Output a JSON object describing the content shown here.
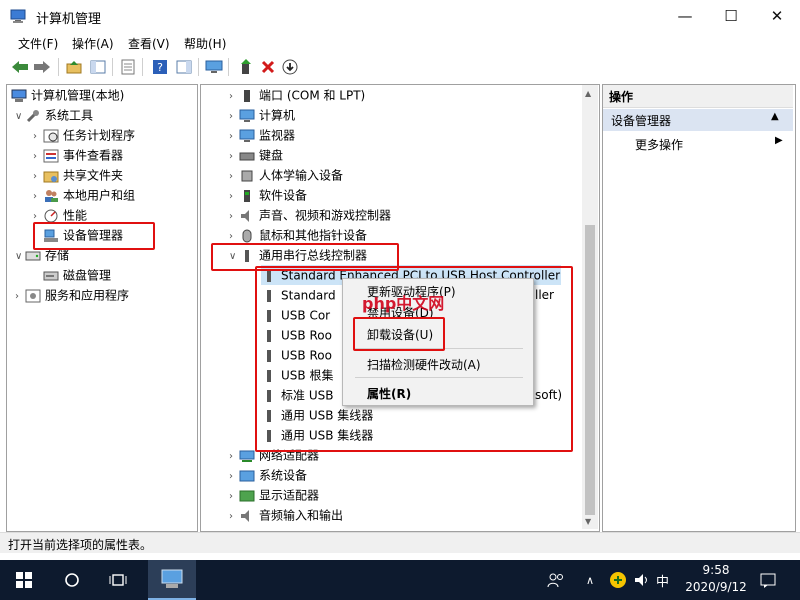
{
  "window": {
    "title": "计算机管理",
    "minimize": "—",
    "maximize": "☐",
    "close": "✕"
  },
  "menu": [
    "文件(F)",
    "操作(A)",
    "查看(V)",
    "帮助(H)"
  ],
  "toolbar_icons": [
    "back-icon",
    "forward-icon",
    "up-folder-icon",
    "show-hide-tree-icon",
    "properties-icon",
    "help-icon",
    "action-pane-icon",
    "monitor-icon",
    "update-driver-icon",
    "uninstall-icon",
    "download-icon"
  ],
  "left_tree": {
    "root": "计算机管理(本地)",
    "system_tools": "系统工具",
    "system_children": [
      "任务计划程序",
      "事件查看器",
      "共享文件夹",
      "本地用户和组",
      "性能",
      "设备管理器"
    ],
    "storage": "存储",
    "disk": "磁盘管理",
    "services": "服务和应用程序"
  },
  "devices": {
    "before": [
      "端口 (COM 和 LPT)",
      "计算机",
      "监视器",
      "键盘",
      "人体学输入设备",
      "软件设备",
      "声音、视频和游戏控制器",
      "鼠标和其他指针设备"
    ],
    "usb_group": "通用串行总线控制器",
    "usb_children": [
      {
        "left": "Standard Enhanced PCI to USB Host Controller",
        "right": ""
      },
      {
        "left": "Standard",
        "right": "ller"
      },
      {
        "left": "USB Cor",
        "right": ""
      },
      {
        "left": "USB Roo",
        "right": ""
      },
      {
        "left": "USB Roo",
        "right": ""
      },
      {
        "left": "USB 根集",
        "right": ""
      },
      {
        "left": "标准 USB",
        "right": "soft)"
      },
      {
        "left": "通用 USB 集线器",
        "right": ""
      },
      {
        "left": "通用 USB 集线器",
        "right": ""
      }
    ],
    "after": [
      "网络适配器",
      "系统设备",
      "显示适配器",
      "音频输入和输出"
    ]
  },
  "context_menu": {
    "update_driver": "更新驱动程序(P)",
    "disable": "禁用设备(D)",
    "uninstall": "卸载设备(U)",
    "scan": "扫描检测硬件改动(A)",
    "properties": "属性(R)"
  },
  "actions": {
    "header": "操作",
    "group": "设备管理器",
    "more": "更多操作"
  },
  "status": "打开当前选择项的属性表。",
  "taskbar": {
    "time": "9:58",
    "date": "2020/9/12",
    "ime": "中"
  },
  "watermark": "php中文网",
  "colors": {
    "highlight_red": "#e01010",
    "taskbar_bg": "#0d1a2e",
    "action_group_bg": "#dbe4f2"
  }
}
